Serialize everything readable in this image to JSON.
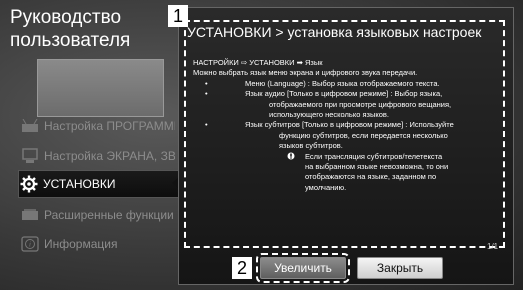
{
  "manual": {
    "title_line1": "Руководство",
    "title_line2": "пользователя"
  },
  "menu": [
    {
      "label": "Настройка ПРОГРАММЫ",
      "icon": "antenna-icon"
    },
    {
      "label": "Настройка ЭКРАНА, ЗВУКА",
      "icon": "monitor-speaker-icon"
    },
    {
      "label": "УСТАНОВКИ",
      "icon": "gear-icon"
    },
    {
      "label": "Расширенные функции",
      "icon": "extended-functions-icon"
    },
    {
      "label": "Информация",
      "icon": "info-icon"
    }
  ],
  "panel": {
    "title": "УСТАНОВКИ > установка языковых настроек",
    "breadcrumb": "НАСТРОЙКИ ⇨ УСТАНОВКИ ➡ Язык",
    "intro": "Можно выбрать язык меню экрана и цифрового звука передачи.",
    "item1": "Меню (Language) : Выбор языка отображаемого текста.",
    "item2_l1": "Язык аудио [Только в цифровом режиме] : Выбор языка,",
    "item2_l2": "отображаемого при просмотре цифрового вещания,",
    "item2_l3": "использующего несколько языков.",
    "item3_l1": "Язык субтитров [Только в цифровом режиме] : Используйте",
    "item3_l2": "функцию субтитров, если передается несколько",
    "item3_l3": "языков субтитров.",
    "note_l1": "Если трансляция субтитров/телетекста",
    "note_l2": "на выбранном языке невозможна, то они",
    "note_l3": "отображаются на языке, заданном по",
    "note_l4": "умолчанию.",
    "page": "1/1"
  },
  "badges": {
    "one": "1",
    "two": "2"
  },
  "buttons": {
    "zoom": "Увеличить",
    "close": "Закрыть"
  }
}
